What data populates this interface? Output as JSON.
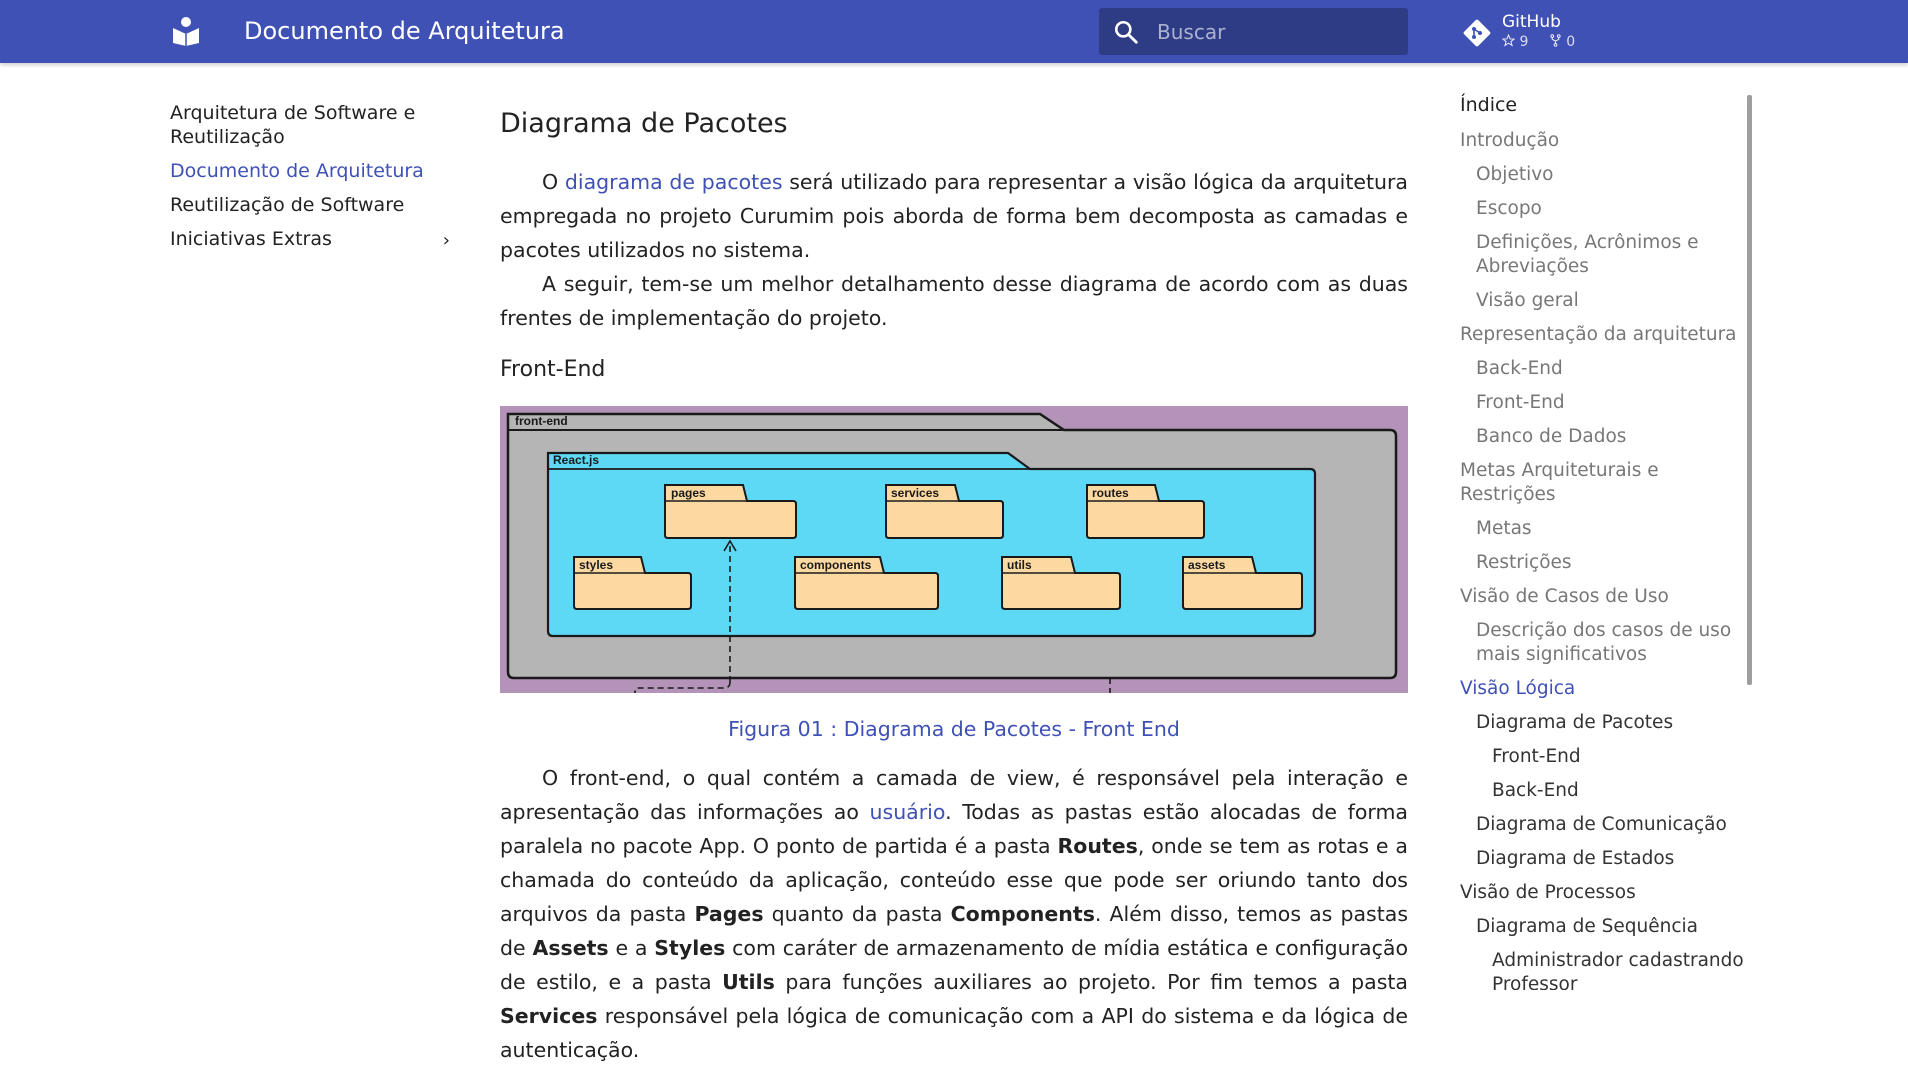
{
  "header": {
    "title": "Documento de Arquitetura",
    "search_placeholder": "Buscar",
    "repo": {
      "name": "GitHub",
      "stars": "9",
      "forks": "0"
    }
  },
  "nav": {
    "items": [
      {
        "label": "Arquitetura de Software e Reutilização"
      },
      {
        "label": "Documento de Arquitetura",
        "active": true
      },
      {
        "label": "Reutilização de Software"
      },
      {
        "label": "Iniciativas Extras",
        "chevron": "›"
      }
    ]
  },
  "content": {
    "title": "Diagrama de Pacotes",
    "p1": {
      "before": "O ",
      "link": "diagrama de pacotes",
      "after": " será utilizado para representar a visão lógica da arquitetura empregada no projeto Curumim pois aborda de forma bem decomposta as camadas e pacotes utilizados no sistema."
    },
    "p2": "A seguir, tem-se um melhor detalhamento desse diagrama de acordo com as duas frentes de implementação do projeto.",
    "section_title": "Front-End",
    "figure": {
      "outer_label": "front-end",
      "inner_label": "React.js",
      "packages": [
        "pages",
        "services",
        "routes",
        "styles",
        "components",
        "utils",
        "assets"
      ],
      "caption": "Figura 01 : Diagrama de Pacotes - Front End"
    },
    "p3": {
      "t1": "O front-end, o qual contém a camada de view, é responsável pela interação e apresentação das informações ao ",
      "link": "usuário",
      "t2": ". Todas as pastas estão alocadas de forma paralela no pacote App. O ponto de partida é a pasta ",
      "b1": "Routes",
      "t3": ", onde se tem as rotas e a chamada do conteúdo da aplicação, conteúdo esse que pode ser oriundo tanto dos arquivos da pasta ",
      "b2": "Pages",
      "t4": " quanto da pasta ",
      "b3": "Components",
      "t5": ". Além disso, temos as pastas de ",
      "b4": "Assets",
      "t6": " e a ",
      "b5": "Styles",
      "t7": " com caráter de armazenamento de mídia estática e configuração de estilo, e a pasta ",
      "b6": "Utils",
      "t8": " para funções auxiliares ao projeto. Por fim temos a pasta ",
      "b7": "Services",
      "t9": " responsável pela lógica de comunicação com a API do sistema e da lógica de autenticação."
    }
  },
  "toc": {
    "title": "Índice",
    "items": [
      {
        "label": "Introdução"
      },
      {
        "label": "Objetivo"
      },
      {
        "label": "Escopo"
      },
      {
        "label": "Definições, Acrônimos e Abreviações"
      },
      {
        "label": "Visão geral"
      },
      {
        "label": "Representação da arquitetura"
      },
      {
        "label": "Back-End"
      },
      {
        "label": "Front-End"
      },
      {
        "label": "Banco de Dados"
      },
      {
        "label": "Metas Arquiteturais e Restrições"
      },
      {
        "label": "Metas"
      },
      {
        "label": "Restrições"
      },
      {
        "label": "Visão de Casos de Uso"
      },
      {
        "label": "Descrição dos casos de uso mais significativos"
      },
      {
        "label": "Visão Lógica"
      },
      {
        "label": "Diagrama de Pacotes"
      },
      {
        "label": "Front-End"
      },
      {
        "label": "Back-End"
      },
      {
        "label": "Diagrama de Comunicação"
      },
      {
        "label": "Diagrama de Estados"
      },
      {
        "label": "Visão de Processos"
      },
      {
        "label": "Diagrama de Sequência"
      },
      {
        "label": "Administrador cadastrando Professor"
      }
    ]
  },
  "colors": {
    "primary": "#3f51b5",
    "figure_bg": "#b393b8",
    "outer_package": "#b5b5b5",
    "react_package": "#5dd8f5",
    "folder": "#fdd9a2"
  },
  "icons": {
    "logo": "book-open-icon",
    "search": "search-icon",
    "repo": "git-icon",
    "star": "star-icon",
    "fork": "fork-icon"
  }
}
